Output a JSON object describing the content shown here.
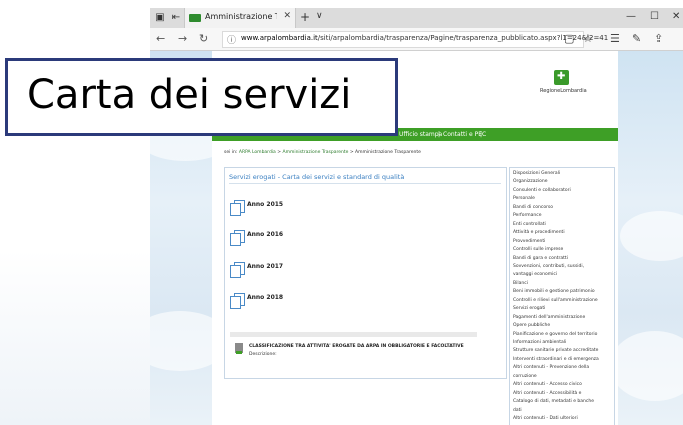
{
  "browser": {
    "tab_title": "Amministrazione Traspa",
    "url_domain": "www.arpalombardia.it",
    "url_path": "/siti/arpalombardia/trasparenza/Pagine/trasparenza_pubblicato.aspx?l1=24&l2=41",
    "tab_close": "✕",
    "tab_new": "+",
    "tab_list": "∨"
  },
  "site": {
    "logo_text": "RegioneLombardia",
    "nav": [
      {
        "label": "Ufficio stampa"
      },
      {
        "label": "Contatti e PEC"
      }
    ],
    "breadcrumb": {
      "prefix": "sei in:",
      "items": [
        "ARPA Lombardia",
        "Amministrazione Trasparente",
        "Amministrazione Trasparente"
      ],
      "separator": ">"
    },
    "section_heading": "Servizi erogati - Carta dei servizi e standard di qualità",
    "years": [
      {
        "label": "Anno 2015"
      },
      {
        "label": "Anno 2016"
      },
      {
        "label": "Anno 2017"
      },
      {
        "label": "Anno 2018"
      }
    ],
    "classification_title": "CLASSIFICAZIONE TRA ATTIVITA' EROGATE DA ARPA IN OBBLIGATORIE E FACOLTATIVE",
    "classification_desc": "Descrizione:",
    "side_menu": [
      "Disposizioni Generali",
      "Organizzazione",
      "Consulenti e collaboratori",
      "Personale",
      "Bandi di concorso",
      "Performance",
      "Enti controllati",
      "Attività e procedimenti",
      "Provvedimenti",
      "Controlli sulle imprese",
      "Bandi di gara e contratti",
      "Sovvenzioni, contributi, sussidi,",
      "vantaggi economici",
      "Bilanci",
      "Beni immobili e gestione patrimonio",
      "Controlli e rilievi sull'amministrazione",
      "Servizi erogati",
      "Pagamenti dell'amministrazione",
      "Opere pubbliche",
      "Pianificazione e governo del territorio",
      "Informazioni ambientali",
      "Strutture sanitarie private accreditate",
      "Interventi straordinari e di emergenza",
      "Altri contenuti - Prevenzione della",
      "corruzione",
      "Altri contenuti - Accesso civico",
      "Altri contenuti - Accessibilità e",
      "Catalogo di dati, metadati e banche",
      "dati",
      "Altri contenuti - Dati ulteriori"
    ]
  },
  "overlay": {
    "text": "Carta dei servizi"
  },
  "colors": {
    "site_green": "#3e9f26",
    "heading_blue": "#3a7fc1",
    "overlay_border": "#2b3a7a"
  }
}
